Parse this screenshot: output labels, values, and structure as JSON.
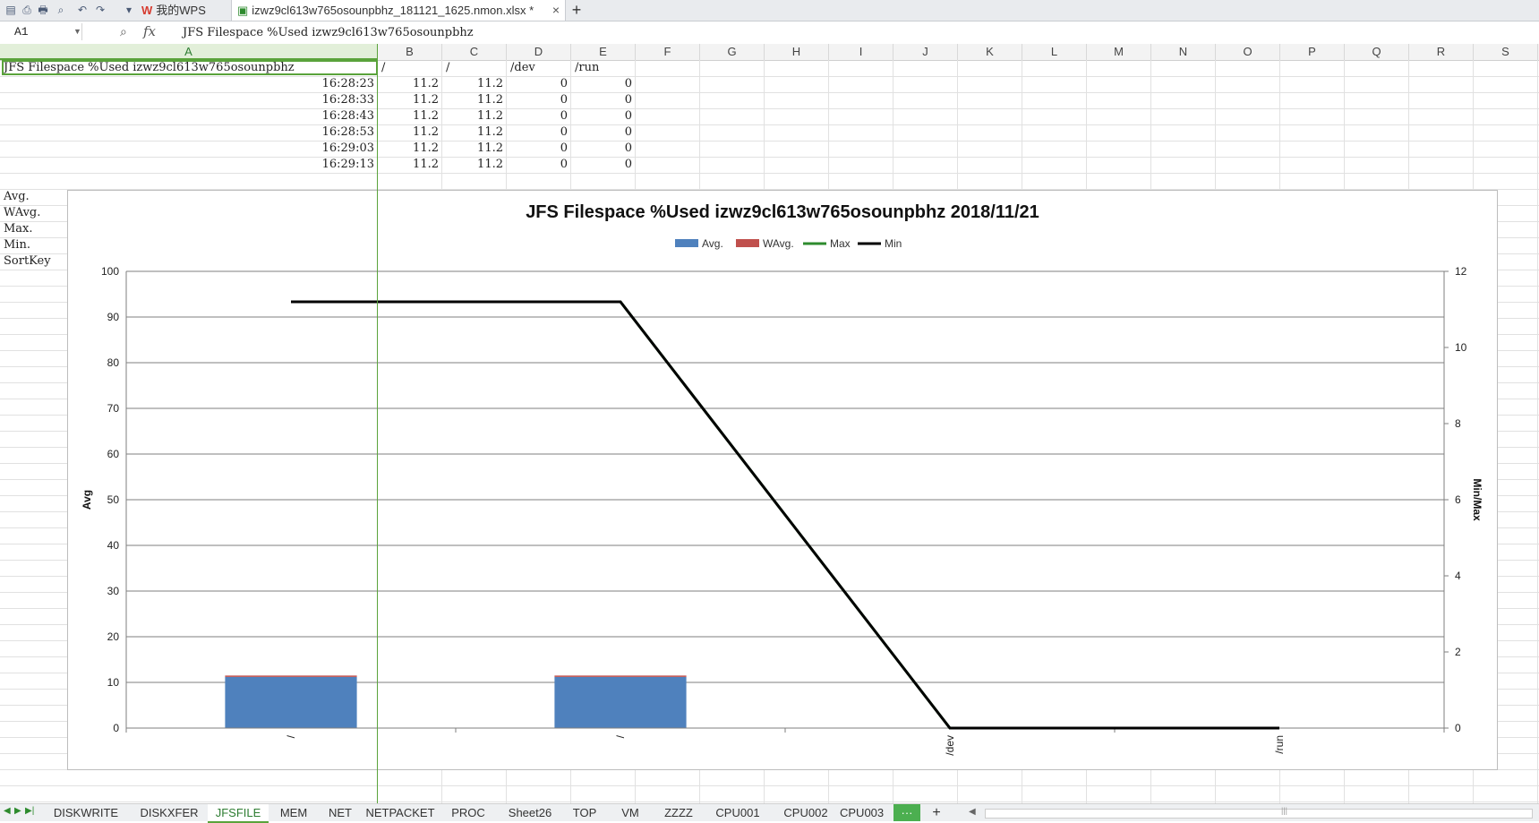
{
  "titlebar": {
    "home_tab": "我的WPS",
    "doc_tab": "izwz9cl613w765osounpbhz_181121_1625.nmon.xlsx *",
    "new_tab": "+"
  },
  "formula_bar": {
    "namebox": "A1",
    "fx": "fx",
    "content": "JFS Filespace %Used izwz9cl613w765osounpbhz"
  },
  "columns": [
    "A",
    "B",
    "C",
    "D",
    "E",
    "F",
    "G",
    "H",
    "I",
    "J",
    "K",
    "L",
    "M",
    "N",
    "O",
    "P",
    "Q",
    "R",
    "S"
  ],
  "sheet": {
    "header_row": [
      "JFS Filespace %Used izwz9cl613w765osounpbhz",
      "/",
      "/",
      "/dev",
      "/run"
    ],
    "rows": [
      [
        "16:28:23",
        "11.2",
        "11.2",
        "0",
        "0"
      ],
      [
        "16:28:33",
        "11.2",
        "11.2",
        "0",
        "0"
      ],
      [
        "16:28:43",
        "11.2",
        "11.2",
        "0",
        "0"
      ],
      [
        "16:28:53",
        "11.2",
        "11.2",
        "0",
        "0"
      ],
      [
        "16:29:03",
        "11.2",
        "11.2",
        "0",
        "0"
      ],
      [
        "16:29:13",
        "11.2",
        "11.2",
        "0",
        "0"
      ]
    ],
    "stat_labels": [
      "Avg.",
      "WAvg.",
      "Max.",
      "Min.",
      "SortKey"
    ]
  },
  "chart_data": {
    "type": "bar",
    "title": "JFS Filespace %Used izwz9cl613w765osounpbhz  2018/11/21",
    "categories": [
      "/",
      "/",
      "/dev",
      "/run"
    ],
    "series": [
      {
        "name": "Avg.",
        "kind": "bar",
        "axis": "left",
        "values": [
          11.2,
          11.2,
          0,
          0
        ],
        "color": "#4f81bd"
      },
      {
        "name": "WAvg.",
        "kind": "bar",
        "axis": "left",
        "values": [
          0.3,
          0.3,
          0,
          0
        ],
        "color": "#c0504d"
      },
      {
        "name": "Max",
        "kind": "line",
        "axis": "right",
        "values": [
          11.2,
          11.2,
          0,
          0
        ],
        "color": "#2e8b2e"
      },
      {
        "name": "Min",
        "kind": "line",
        "axis": "right",
        "values": [
          11.2,
          11.2,
          0,
          0
        ],
        "color": "#000000"
      }
    ],
    "ylabel": "Avg",
    "y2label": "Min/Max",
    "ylim": [
      0,
      100
    ],
    "y2lim": [
      0,
      12
    ],
    "yticks": [
      "0",
      "10",
      "20",
      "30",
      "40",
      "50",
      "60",
      "70",
      "80",
      "90",
      "100"
    ],
    "y2ticks": [
      "0",
      "2",
      "4",
      "6",
      "8",
      "10",
      "12"
    ],
    "grid": true,
    "legend": "top"
  },
  "sheet_tabs": [
    "DISKWRITE",
    "DISKXFER",
    "JFSFILE",
    "MEM",
    "NET",
    "NETPACKET",
    "PROC",
    "Sheet26",
    "TOP",
    "VM",
    "ZZZZ",
    "CPU001",
    "CPU002",
    "CPU003"
  ],
  "active_sheet": "JFSFILE",
  "more_label": "···",
  "add_sheet_label": "+",
  "colors": {
    "accent": "#5aa33b",
    "bar": "#4f81bd",
    "wavg": "#c0504d",
    "max": "#2e8b2e",
    "min": "#000000"
  }
}
